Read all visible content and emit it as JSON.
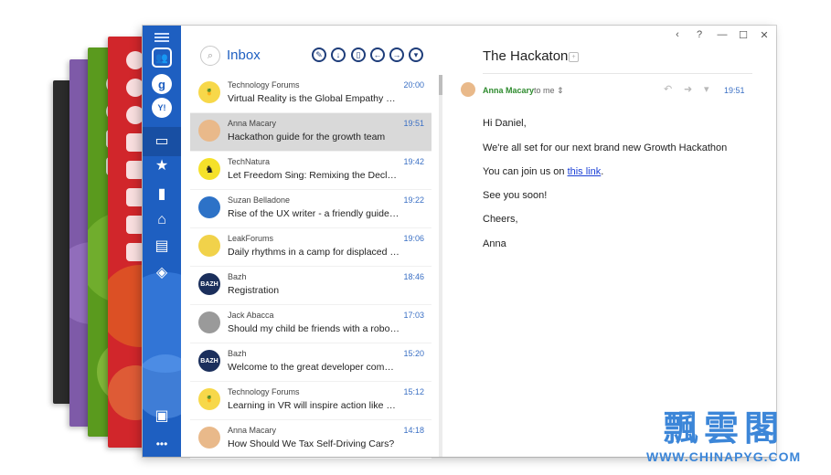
{
  "inbox": {
    "title": "Inbox",
    "toolbar": [
      "compose-icon",
      "download-icon",
      "trash-icon",
      "reply-icon",
      "forward-icon",
      "more-dropdown-icon"
    ]
  },
  "sidebar": {
    "accounts": [
      "contacts-icon",
      "g",
      "Y!"
    ],
    "folders": [
      "inbox-icon",
      "star-icon",
      "draft-icon",
      "archive-icon",
      "briefcase-icon",
      "tag-icon"
    ],
    "bottom": [
      "contacts-book-icon",
      "more-icon"
    ],
    "bottom_more": "•••",
    "accent_color": "#1e5fc1"
  },
  "themes": [
    {
      "name": "dark",
      "color": "#2b2b2b"
    },
    {
      "name": "purple",
      "color": "#7e5aa8"
    },
    {
      "name": "green",
      "color": "#5a9a1e"
    },
    {
      "name": "red",
      "color": "#d1262b"
    }
  ],
  "messages": [
    {
      "sender": "Technology Forums",
      "subject": "Virtual Reality is the Global Empathy Ma…",
      "time": "20:00",
      "avatar": "pineapple",
      "avatar_bg": "#f7d84a",
      "avatar_text": "",
      "selected": false
    },
    {
      "sender": "Anna Macary",
      "subject": "Hackathon guide for the growth team",
      "time": "19:51",
      "avatar": "person",
      "avatar_bg": "#e9b98a",
      "avatar_text": "",
      "selected": true
    },
    {
      "sender": "TechNatura",
      "subject": "Let Freedom Sing: Remixing the Declarati…",
      "time": "19:42",
      "avatar": "deer",
      "avatar_bg": "#f5e12a",
      "avatar_text": "",
      "selected": false
    },
    {
      "sender": "Suzan Belladone",
      "subject": "Rise of the UX writer - a friendly guide of…",
      "time": "19:22",
      "avatar": "person",
      "avatar_bg": "#2d72c7",
      "avatar_text": "",
      "selected": false
    },
    {
      "sender": "LeakForums",
      "subject": "Daily rhythms in a camp for displaced pe…",
      "time": "19:06",
      "avatar": "lego",
      "avatar_bg": "#f1d24a",
      "avatar_text": "",
      "selected": false
    },
    {
      "sender": "Bazh",
      "subject": "Registration",
      "time": "18:46",
      "avatar": "logo",
      "avatar_bg": "#1b2f5c",
      "avatar_text": "BAZH",
      "selected": false
    },
    {
      "sender": "Jack Abacca",
      "subject": "Should my child be friends with a robot…",
      "time": "17:03",
      "avatar": "person",
      "avatar_bg": "#9a9a9a",
      "avatar_text": "",
      "selected": false
    },
    {
      "sender": "Bazh",
      "subject": "Welcome to the great developer commu…",
      "time": "15:20",
      "avatar": "logo",
      "avatar_bg": "#1b2f5c",
      "avatar_text": "BAZH",
      "selected": false
    },
    {
      "sender": "Technology Forums",
      "subject": "Learning in VR will inspire action like nev…",
      "time": "15:12",
      "avatar": "pineapple",
      "avatar_bg": "#f7d84a",
      "avatar_text": "",
      "selected": false
    },
    {
      "sender": "Anna Macary",
      "subject": "How Should We Tax Self-Driving Cars?",
      "time": "14:18",
      "avatar": "person",
      "avatar_bg": "#e9b98a",
      "avatar_text": "",
      "selected": false
    }
  ],
  "window_controls": {
    "back": "‹",
    "help": "?",
    "minimize": "—",
    "maximize": "☐",
    "close": "✕"
  },
  "reader": {
    "subject": "The Hackaton",
    "from_name": "Anna Macary",
    "to": "to me ⇕",
    "time": "19:51",
    "greeting": "Hi Daniel,",
    "line1": "We're all set for our next brand new Growth Hackathon",
    "line2_pre": "You can join us on ",
    "line2_link": "this link",
    "line2_post": ".",
    "line3": "See you soon!",
    "signoff": "Cheers,",
    "signature": "Anna"
  },
  "watermark": {
    "title": "飄雲閣",
    "url": "WWW.CHINAPYG.COM"
  }
}
